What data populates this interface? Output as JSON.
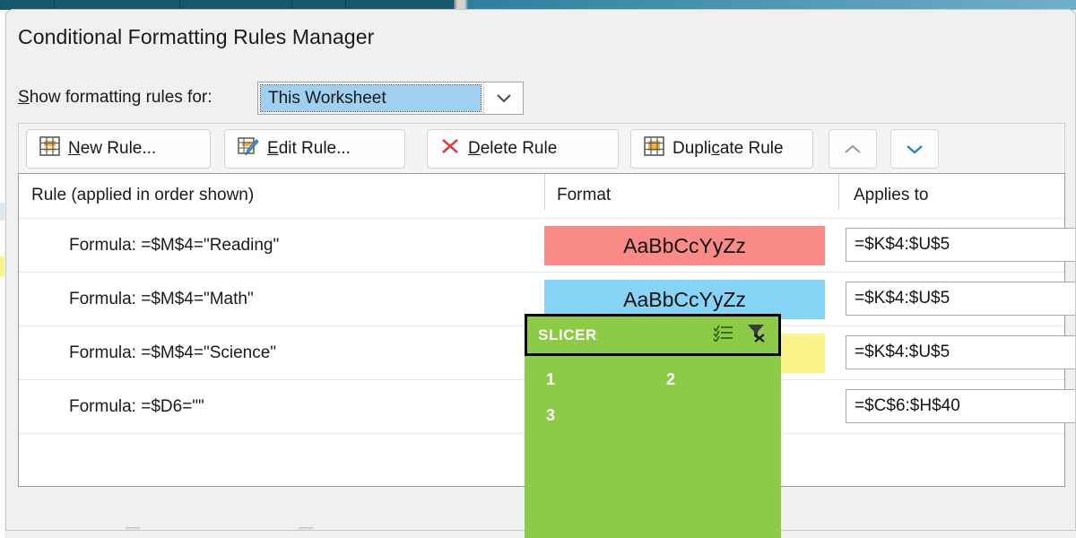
{
  "dialog": {
    "title": "Conditional Formatting Rules Manager"
  },
  "scope": {
    "label_prefix": "S",
    "label_rest": "how formatting rules for:",
    "selected": "This Worksheet",
    "arrow_icon": "chevron-down-icon"
  },
  "toolbar": {
    "new_rule": {
      "pre": "",
      "accel": "N",
      "post": "ew Rule...",
      "icon": "new-rule-grid-icon"
    },
    "edit_rule": {
      "pre": "",
      "accel": "E",
      "post": "dit Rule...",
      "icon": "edit-rule-pencil-icon"
    },
    "delete_rule": {
      "pre": "",
      "accel": "D",
      "post": "elete Rule",
      "icon": "delete-x-icon"
    },
    "duplicate_rule": {
      "pre": "Dupli",
      "accel": "c",
      "post": "ate Rule",
      "icon": "duplicate-grid-icon"
    },
    "move_up": {
      "icon": "chevron-up-icon",
      "enabled": "false"
    },
    "move_down": {
      "icon": "chevron-down-icon",
      "enabled": "true"
    }
  },
  "list": {
    "columns": [
      "Rule (applied in order shown)",
      "Format",
      "Applies to"
    ],
    "rows": [
      {
        "rule": "Formula: =$M$4=\"Reading\"",
        "format_sample": "AaBbCcYyZz",
        "format_fill": "#F98A85",
        "format_text_color": "#111111",
        "applies_to": "=$K$4:$U$5"
      },
      {
        "rule": "Formula: =$M$4=\"Math\"",
        "format_sample": "AaBbCcYyZz",
        "format_fill": "#85D4F5",
        "format_text_color": "#111111",
        "applies_to": "=$K$4:$U$5"
      },
      {
        "rule": "Formula: =$M$4=\"Science\"",
        "format_sample": "",
        "format_fill": "#FBF48A",
        "format_text_color": "#111111",
        "applies_to": "=$K$4:$U$5"
      },
      {
        "rule": "Formula: =$D6=\"\"",
        "format_sample": "",
        "format_fill": "#FFFFFF",
        "format_text_color": "#111111",
        "applies_to": "=$C$6:$H$40"
      }
    ]
  },
  "slicer": {
    "title": "SLICER",
    "fill_color": "#8BCB45",
    "multiselect_icon": "multi-select-icon",
    "clear_filter_icon": "clear-filter-funnel-icon",
    "items": [
      "1",
      "2",
      "3"
    ]
  }
}
